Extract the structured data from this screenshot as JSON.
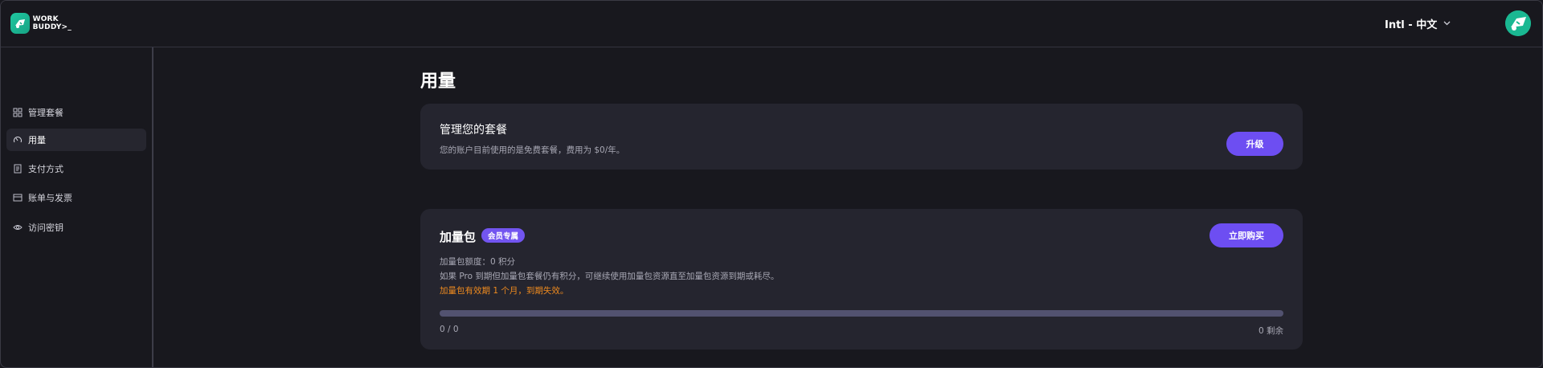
{
  "brand": {
    "logo_text_line1": "WORK",
    "logo_text_line2": "BUDDY>_"
  },
  "header": {
    "language_label": "Intl - 中文"
  },
  "sidebar": {
    "items": [
      {
        "label": "管理套餐",
        "icon": "grid-icon",
        "active": false
      },
      {
        "label": "用量",
        "icon": "gauge-icon",
        "active": true
      },
      {
        "label": "支付方式",
        "icon": "document-icon",
        "active": false
      },
      {
        "label": "账单与发票",
        "icon": "card-icon",
        "active": false
      },
      {
        "label": "访问密钥",
        "icon": "eye-icon",
        "active": false
      }
    ]
  },
  "main": {
    "title": "用量",
    "plan_card": {
      "title": "管理您的套餐",
      "description": "您的账户目前使用的是免费套餐，费用为 $0/年。",
      "upgrade_label": "升级"
    },
    "addon_card": {
      "title": "加量包",
      "badge": "会员专属",
      "buy_label": "立即购买",
      "quota_line": "加量包额度：0 积分",
      "info_line": "如果 Pro 到期但加量包套餐仍有积分，可继续使用加量包资源直至加量包资源到期或耗尽。",
      "warning_line": "加量包有效期 1 个月，到期失效。",
      "progress_used_text": "0 / 0",
      "progress_remaining_text": "0 剩余",
      "progress_fraction": 0
    }
  },
  "colors": {
    "background": "#18181e",
    "card": "#25252f",
    "accent": "#6d4ef2",
    "warning": "#ee8a1f",
    "brand": "#1fc7a0"
  }
}
